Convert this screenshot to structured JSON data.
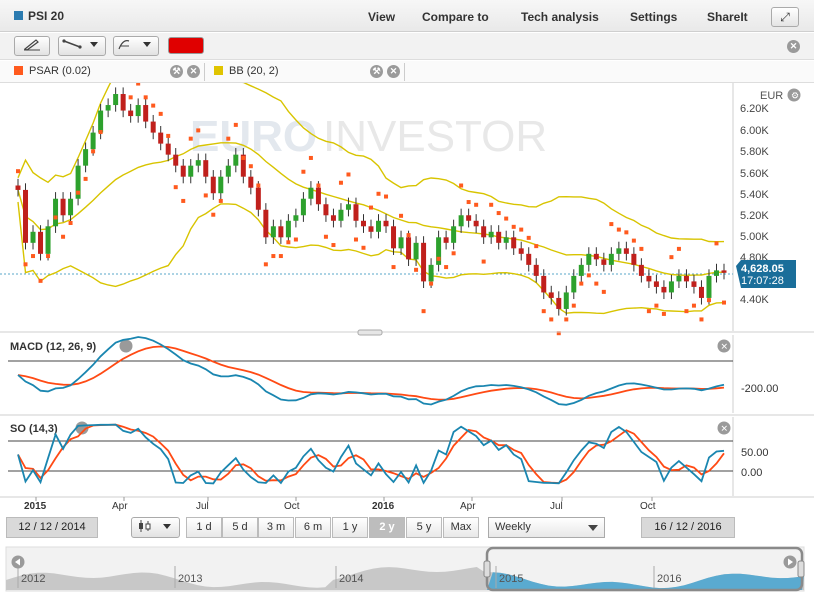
{
  "header": {
    "instrument": "PSI 20",
    "menu": [
      "View",
      "Compare to",
      "Tech analysis",
      "Settings",
      "ShareIt"
    ],
    "fullscreen_icon": "expand-icon"
  },
  "toolbar": {
    "tools": [
      "pencil-icon",
      "line-tool-icon",
      "fibonacci-icon"
    ],
    "line_color": "#e00000"
  },
  "indicators": {
    "psar": {
      "label": "PSAR (0.02)",
      "color": "#ff5a1e"
    },
    "bb": {
      "label": "BB (20, 2)",
      "color": "#e0c400"
    }
  },
  "watermark": {
    "left": "EURO",
    "right": "INVESTOR"
  },
  "price_panel": {
    "currency": "EUR",
    "axis_ticks": [
      "6.20K",
      "6.00K",
      "5.80K",
      "5.60K",
      "5.40K",
      "5.20K",
      "5.00K",
      "4.80K",
      "4.40K"
    ],
    "last_price": "4,628.05",
    "last_time": "17:07:28"
  },
  "macd_panel": {
    "label": "MACD (12, 26, 9)",
    "tick": "-200.00"
  },
  "so_panel": {
    "label": "SO (14,3)",
    "ticks": [
      "50.00",
      "0.00"
    ]
  },
  "x_axis": [
    "2015",
    "Apr",
    "Jul",
    "Oct",
    "2016",
    "Apr",
    "Jul",
    "Oct"
  ],
  "controls": {
    "start_date": "12 / 12 / 2014",
    "end_date": "16 / 12 / 2016",
    "ranges": [
      "1 d",
      "5 d",
      "3 m",
      "6 m",
      "1 y",
      "2 y",
      "5 y",
      "Max"
    ],
    "active_range": "2 y",
    "interval": "Weekly"
  },
  "navigator": {
    "years": [
      "2012",
      "2013",
      "2014",
      "2015",
      "2016"
    ]
  },
  "chart_data": {
    "type": "candlestick",
    "interval": "Weekly",
    "ylabel": "EUR",
    "ylim": [
      4100,
      6350
    ],
    "note_axis": "x runs from Dec 2014 to Dec 2016",
    "close": [
      5380,
      4900,
      5000,
      4800,
      5050,
      5300,
      5150,
      5300,
      5600,
      5750,
      5900,
      6100,
      6150,
      6250,
      6100,
      6050,
      6150,
      6000,
      5900,
      5800,
      5700,
      5600,
      5500,
      5600,
      5650,
      5500,
      5350,
      5500,
      5600,
      5700,
      5500,
      5400,
      5200,
      4950,
      5050,
      4950,
      5100,
      5150,
      5300,
      5400,
      5250,
      5150,
      5100,
      5200,
      5250,
      5100,
      5050,
      5000,
      5100,
      5050,
      4850,
      4950,
      4750,
      4900,
      4550,
      4700,
      4950,
      4900,
      5050,
      5150,
      5100,
      5050,
      4950,
      5000,
      4900,
      4950,
      4850,
      4800,
      4700,
      4600,
      4450,
      4400,
      4300,
      4450,
      4600,
      4700,
      4800,
      4750,
      4700,
      4800,
      4850,
      4800,
      4700,
      4600,
      4550,
      4500,
      4450,
      4550,
      4600,
      4550,
      4500,
      4400,
      4600,
      4650,
      4628
    ]
  }
}
